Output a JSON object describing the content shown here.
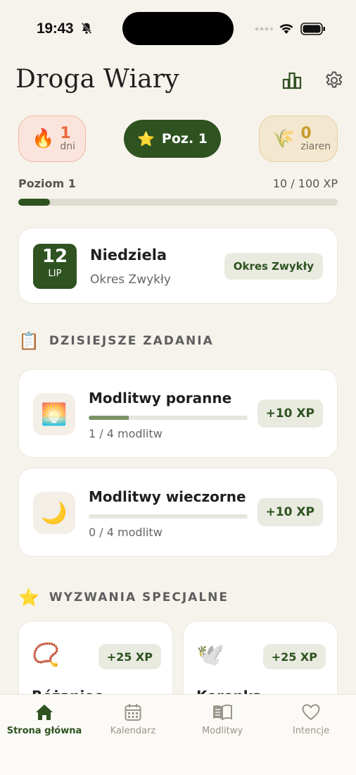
{
  "status_bar": {
    "time": "19:43"
  },
  "header": {
    "title": "Droga Wiary"
  },
  "stats": {
    "streak": {
      "emoji": "🔥",
      "value": "1",
      "unit": "dni"
    },
    "level": {
      "emoji": "⭐",
      "label": "Poz. 1"
    },
    "seeds": {
      "emoji": "🌾",
      "value": "0",
      "unit": "ziaren"
    }
  },
  "progress": {
    "level_label": "Poziom 1",
    "xp_text": "10 / 100 XP",
    "xp_fraction": 0.1
  },
  "today": {
    "day": "12",
    "month": "LIP",
    "name": "Niedziela",
    "season": "Okres Zwykły",
    "season_badge": "Okres Zwykły"
  },
  "tasks_section": {
    "emoji": "📋",
    "title": "DZISIEJSZE ZADANIA",
    "items": [
      {
        "emoji": "🌅",
        "name": "Modlitwy poranne",
        "progress_text": "1 / 4 modlitw",
        "fraction": 0.25,
        "xp": "+10 XP"
      },
      {
        "emoji": "🌙",
        "name": "Modlitwy wieczorne",
        "progress_text": "0 / 4 modlitw",
        "fraction": 0,
        "xp": "+10 XP"
      }
    ]
  },
  "challenges_section": {
    "emoji": "⭐",
    "title": "WYZWANIA SPECJALNE",
    "items": [
      {
        "emoji": "📿",
        "name": "Różaniec",
        "xp": "+25 XP"
      },
      {
        "emoji": "🕊️",
        "name": "Koronka",
        "xp": "+25 XP"
      }
    ]
  },
  "tabbar": {
    "tabs": [
      {
        "label": "Strona główna",
        "icon": "home-icon",
        "active": true
      },
      {
        "label": "Kalendarz",
        "icon": "calendar-icon"
      },
      {
        "label": "Modlitwy",
        "icon": "book-icon"
      },
      {
        "label": "Intencje",
        "icon": "heart-icon"
      }
    ]
  },
  "colors": {
    "primary": "#2e5220",
    "background": "#f6f3ec",
    "streak": "#e8693d",
    "seeds": "#c99a2e"
  }
}
